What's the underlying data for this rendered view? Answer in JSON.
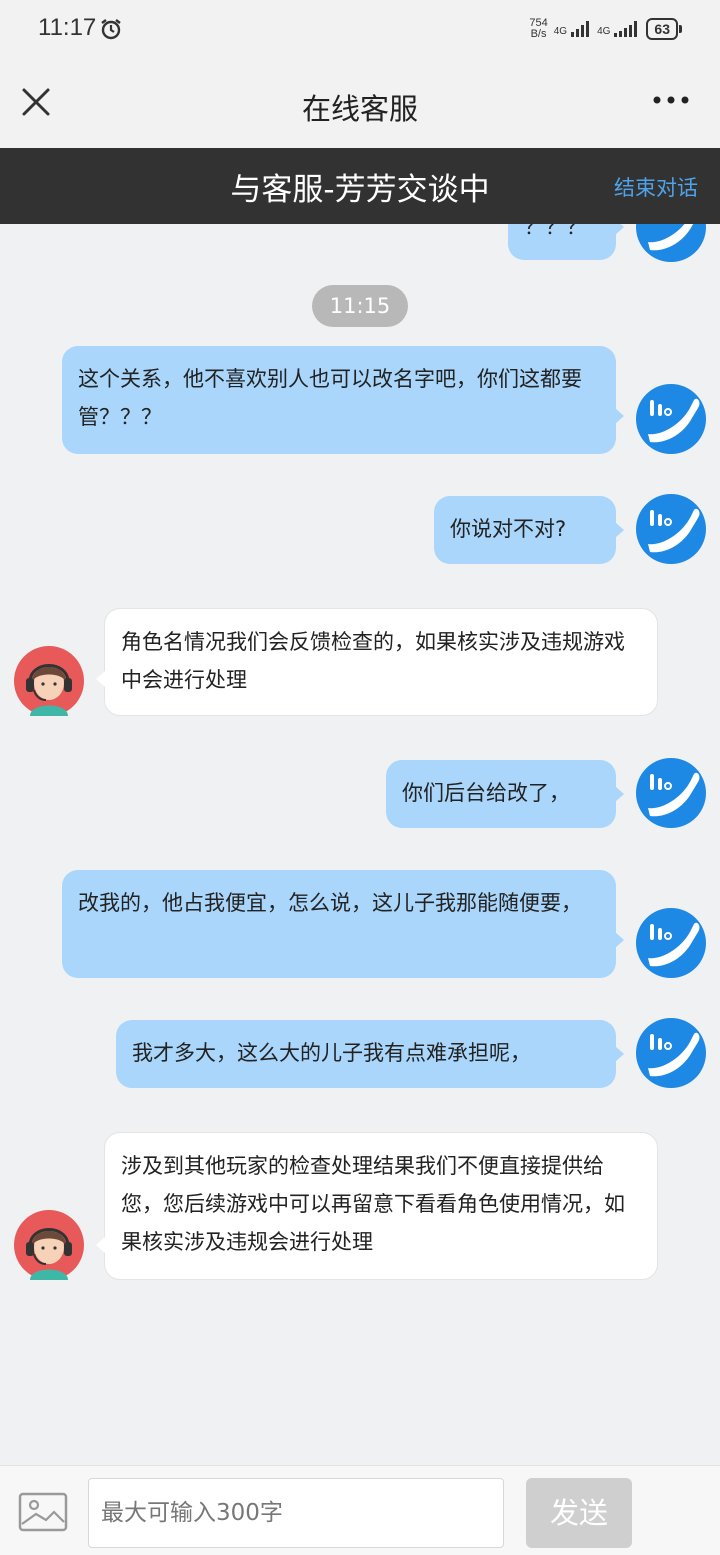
{
  "status_bar": {
    "time": "11:17",
    "net_speed_value": "754",
    "net_speed_unit": "B/s",
    "signal1_label": "4G",
    "signal2_label": "4G",
    "battery": "63"
  },
  "header": {
    "title": "在线客服"
  },
  "banner": {
    "text": "与客服-芳芳交谈中",
    "end_chat_label": "结束对话"
  },
  "chat": {
    "timestamp": "11:15",
    "messages": [
      {
        "sender": "user",
        "text": "？？？"
      },
      {
        "sender": "user",
        "text": "这个关系，他不喜欢别人也可以改名字吧，你们这都要管？？？"
      },
      {
        "sender": "user",
        "text": "你说对不对?"
      },
      {
        "sender": "agent",
        "text": "角色名情况我们会反馈检查的，如果核实涉及违规游戏中会进行处理"
      },
      {
        "sender": "user",
        "text": "你们后台给改了，"
      },
      {
        "sender": "user",
        "text": "改我的，他占我便宜，怎么说，这儿子我那能随便要，"
      },
      {
        "sender": "user",
        "text": "我才多大，这么大的儿子我有点难承担呢，"
      },
      {
        "sender": "agent",
        "text": "涉及到其他玩家的检查处理结果我们不便直接提供给您，您后续游戏中可以再留意下看看角色使用情况，如果核实涉及违规会进行处理"
      }
    ]
  },
  "input_bar": {
    "placeholder": "最大可输入300字",
    "send_label": "发送"
  },
  "colors": {
    "user_bubble": "#a9d6fa",
    "banner_bg": "#323232",
    "accent": "#4ea3ea",
    "user_avatar": "#1e88e5"
  }
}
